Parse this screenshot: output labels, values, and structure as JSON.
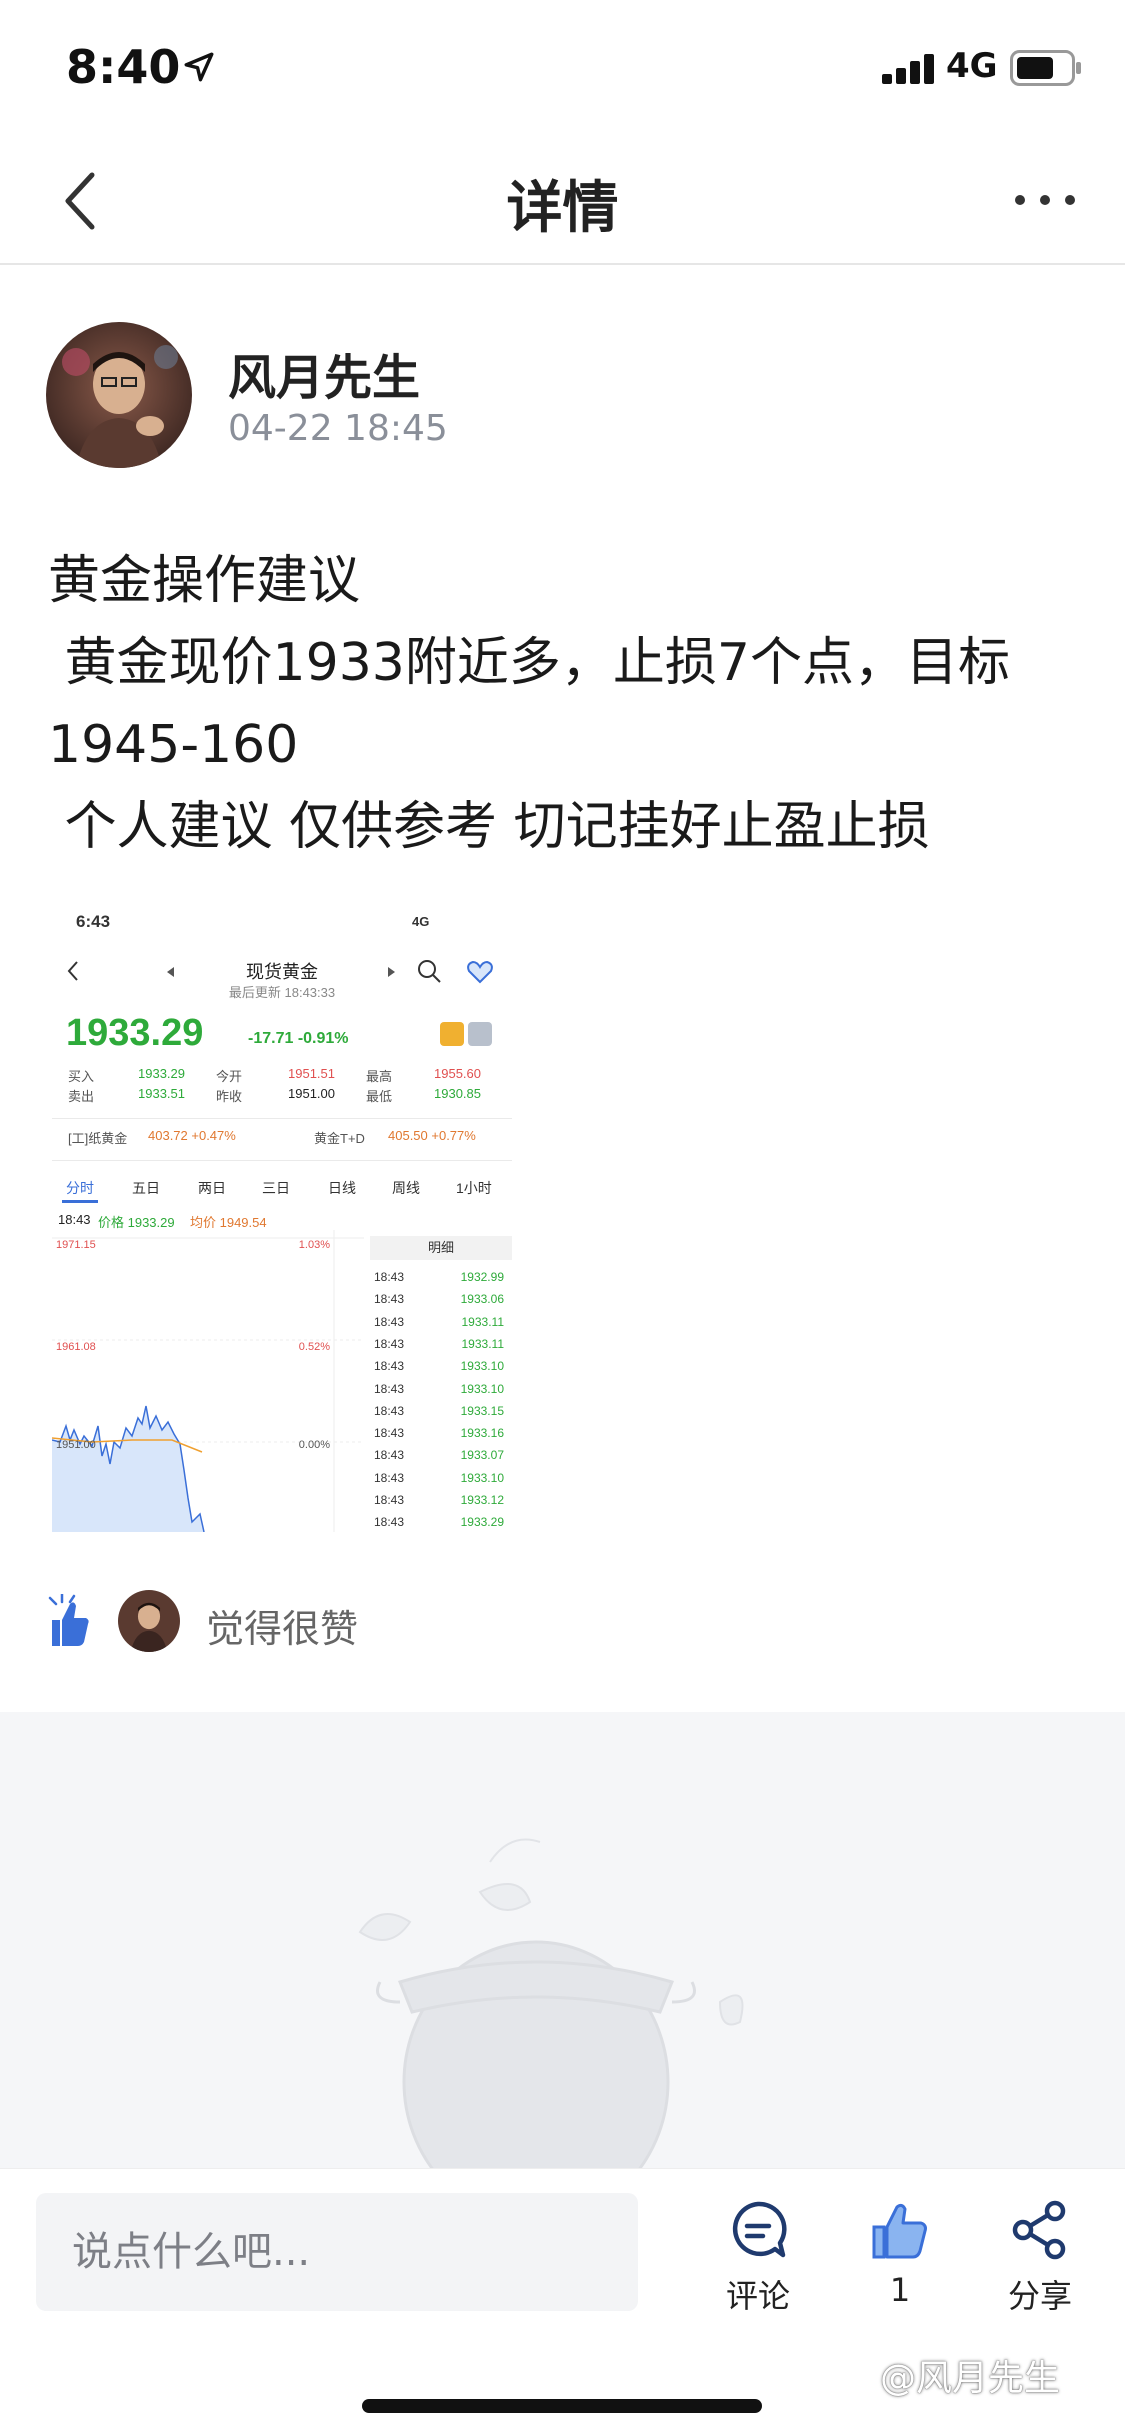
{
  "status_bar": {
    "time": "8:40",
    "network": "4G"
  },
  "nav": {
    "title": "详情"
  },
  "author": {
    "name": "风月先生",
    "time": "04-22 18:45"
  },
  "post": {
    "lines": [
      "黄金操作建议",
      " 黄金现价1933附近多，止损7个点，目标",
      "1945-160",
      " 个人建议 仅供参考 切记挂好止盈止损"
    ]
  },
  "screenshot": {
    "time": "6:43",
    "network": "4G",
    "title": "现货黄金",
    "subtitle": "最后更新 18:43:33",
    "price": "1933.29",
    "change": "-17.71 -0.91%",
    "quotes": {
      "buy_label": "买入",
      "buy": "1933.29",
      "sell_label": "卖出",
      "sell": "1933.51",
      "open_label": "今开",
      "open": "1951.51",
      "prev_label": "昨收",
      "prev": "1951.00",
      "high_label": "最高",
      "high": "1955.60",
      "low_label": "最低",
      "low": "1930.85"
    },
    "related": {
      "left_label": "[工]纸黄金",
      "left_value": "403.72 +0.47%",
      "right_label": "黄金T+D",
      "right_value": "405.50 +0.77%"
    },
    "tabs": [
      "分时",
      "五日",
      "两日",
      "三日",
      "日线",
      "周线",
      "1小时"
    ],
    "chart_header": {
      "time": "18:43",
      "price": "价格 1933.29",
      "avg": "均价 1949.54"
    },
    "axis": {
      "top_left": "1971.15",
      "mid_left": "1961.08",
      "base_left": "1951.00",
      "top_right": "1.03%",
      "mid_right": "0.52%",
      "base_right": "0.00%"
    },
    "detail_head": "明细",
    "detail_rows": [
      {
        "time": "18:43",
        "price": "1932.99"
      },
      {
        "time": "18:43",
        "price": "1933.06"
      },
      {
        "time": "18:43",
        "price": "1933.11"
      },
      {
        "time": "18:43",
        "price": "1933.11"
      },
      {
        "time": "18:43",
        "price": "1933.10"
      },
      {
        "time": "18:43",
        "price": "1933.10"
      },
      {
        "time": "18:43",
        "price": "1933.15"
      },
      {
        "time": "18:43",
        "price": "1933.16"
      },
      {
        "time": "18:43",
        "price": "1933.07"
      },
      {
        "time": "18:43",
        "price": "1933.10"
      },
      {
        "time": "18:43",
        "price": "1933.12"
      },
      {
        "time": "18:43",
        "price": "1933.29"
      }
    ]
  },
  "likes": {
    "text": "觉得很赞"
  },
  "bottom": {
    "placeholder": "说点什么吧...",
    "comment_label": "评论",
    "like_count": "1",
    "share_label": "分享",
    "watermark": "@风月先生"
  },
  "colors": {
    "accent": "#3a6fd8",
    "up": "#e05050",
    "down": "#2eaa3a"
  }
}
